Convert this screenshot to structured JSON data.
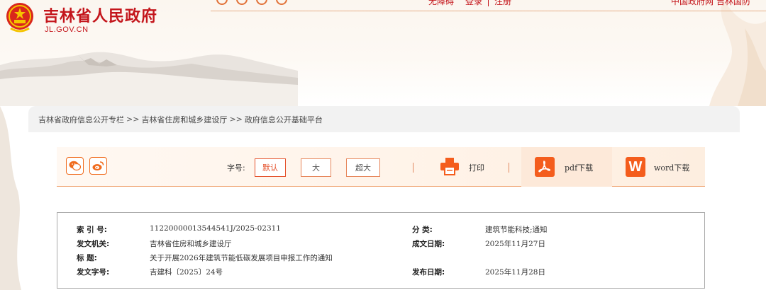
{
  "header": {
    "site_name": "吉林省人民政府",
    "site_domain": "JL.GOV.CN",
    "nav": [
      "无障碍",
      "登录",
      "注册"
    ],
    "top_right": "中国政府网  吉林国防"
  },
  "breadcrumb": {
    "items": [
      "吉林省政府信息公开专栏",
      "吉林省住房和城乡建设厅",
      "政府信息公开基础平台"
    ],
    "separator": ">>"
  },
  "toolbar": {
    "font_size_label": "字号:",
    "font_sizes": [
      "默认",
      "大",
      "超大"
    ],
    "print_label": "打印",
    "pdf_label": "pdf下载",
    "word_label": "word下载",
    "word_icon_letter": "W"
  },
  "info": {
    "index_label": "索 引 号:",
    "index_value": "11220000013544541J/2025-02311",
    "category_label": "分    类:",
    "category_value": "建筑节能科技;通知",
    "issuer_label": "发文机关:",
    "issuer_value": "吉林省住房和城乡建设厅",
    "created_label": "成文日期:",
    "created_value": "2025年11月27日",
    "title_label": "标    题:",
    "title_value": "关于开展2026年建筑节能低碳发展项目申报工作的通知",
    "doc_no_label": "发文字号:",
    "doc_no_value": "吉建科〔2025〕24号",
    "published_label": "发布日期:",
    "published_value": "2025年11月28日"
  },
  "colors": {
    "brand_red": "#c4161c",
    "accent_orange": "#f45d1d"
  },
  "icons": {
    "emblem": "national-emblem-icon",
    "wechat": "wechat-icon",
    "weibo": "weibo-icon",
    "print": "printer-icon",
    "pdf": "pdf-icon",
    "word": "word-icon"
  }
}
